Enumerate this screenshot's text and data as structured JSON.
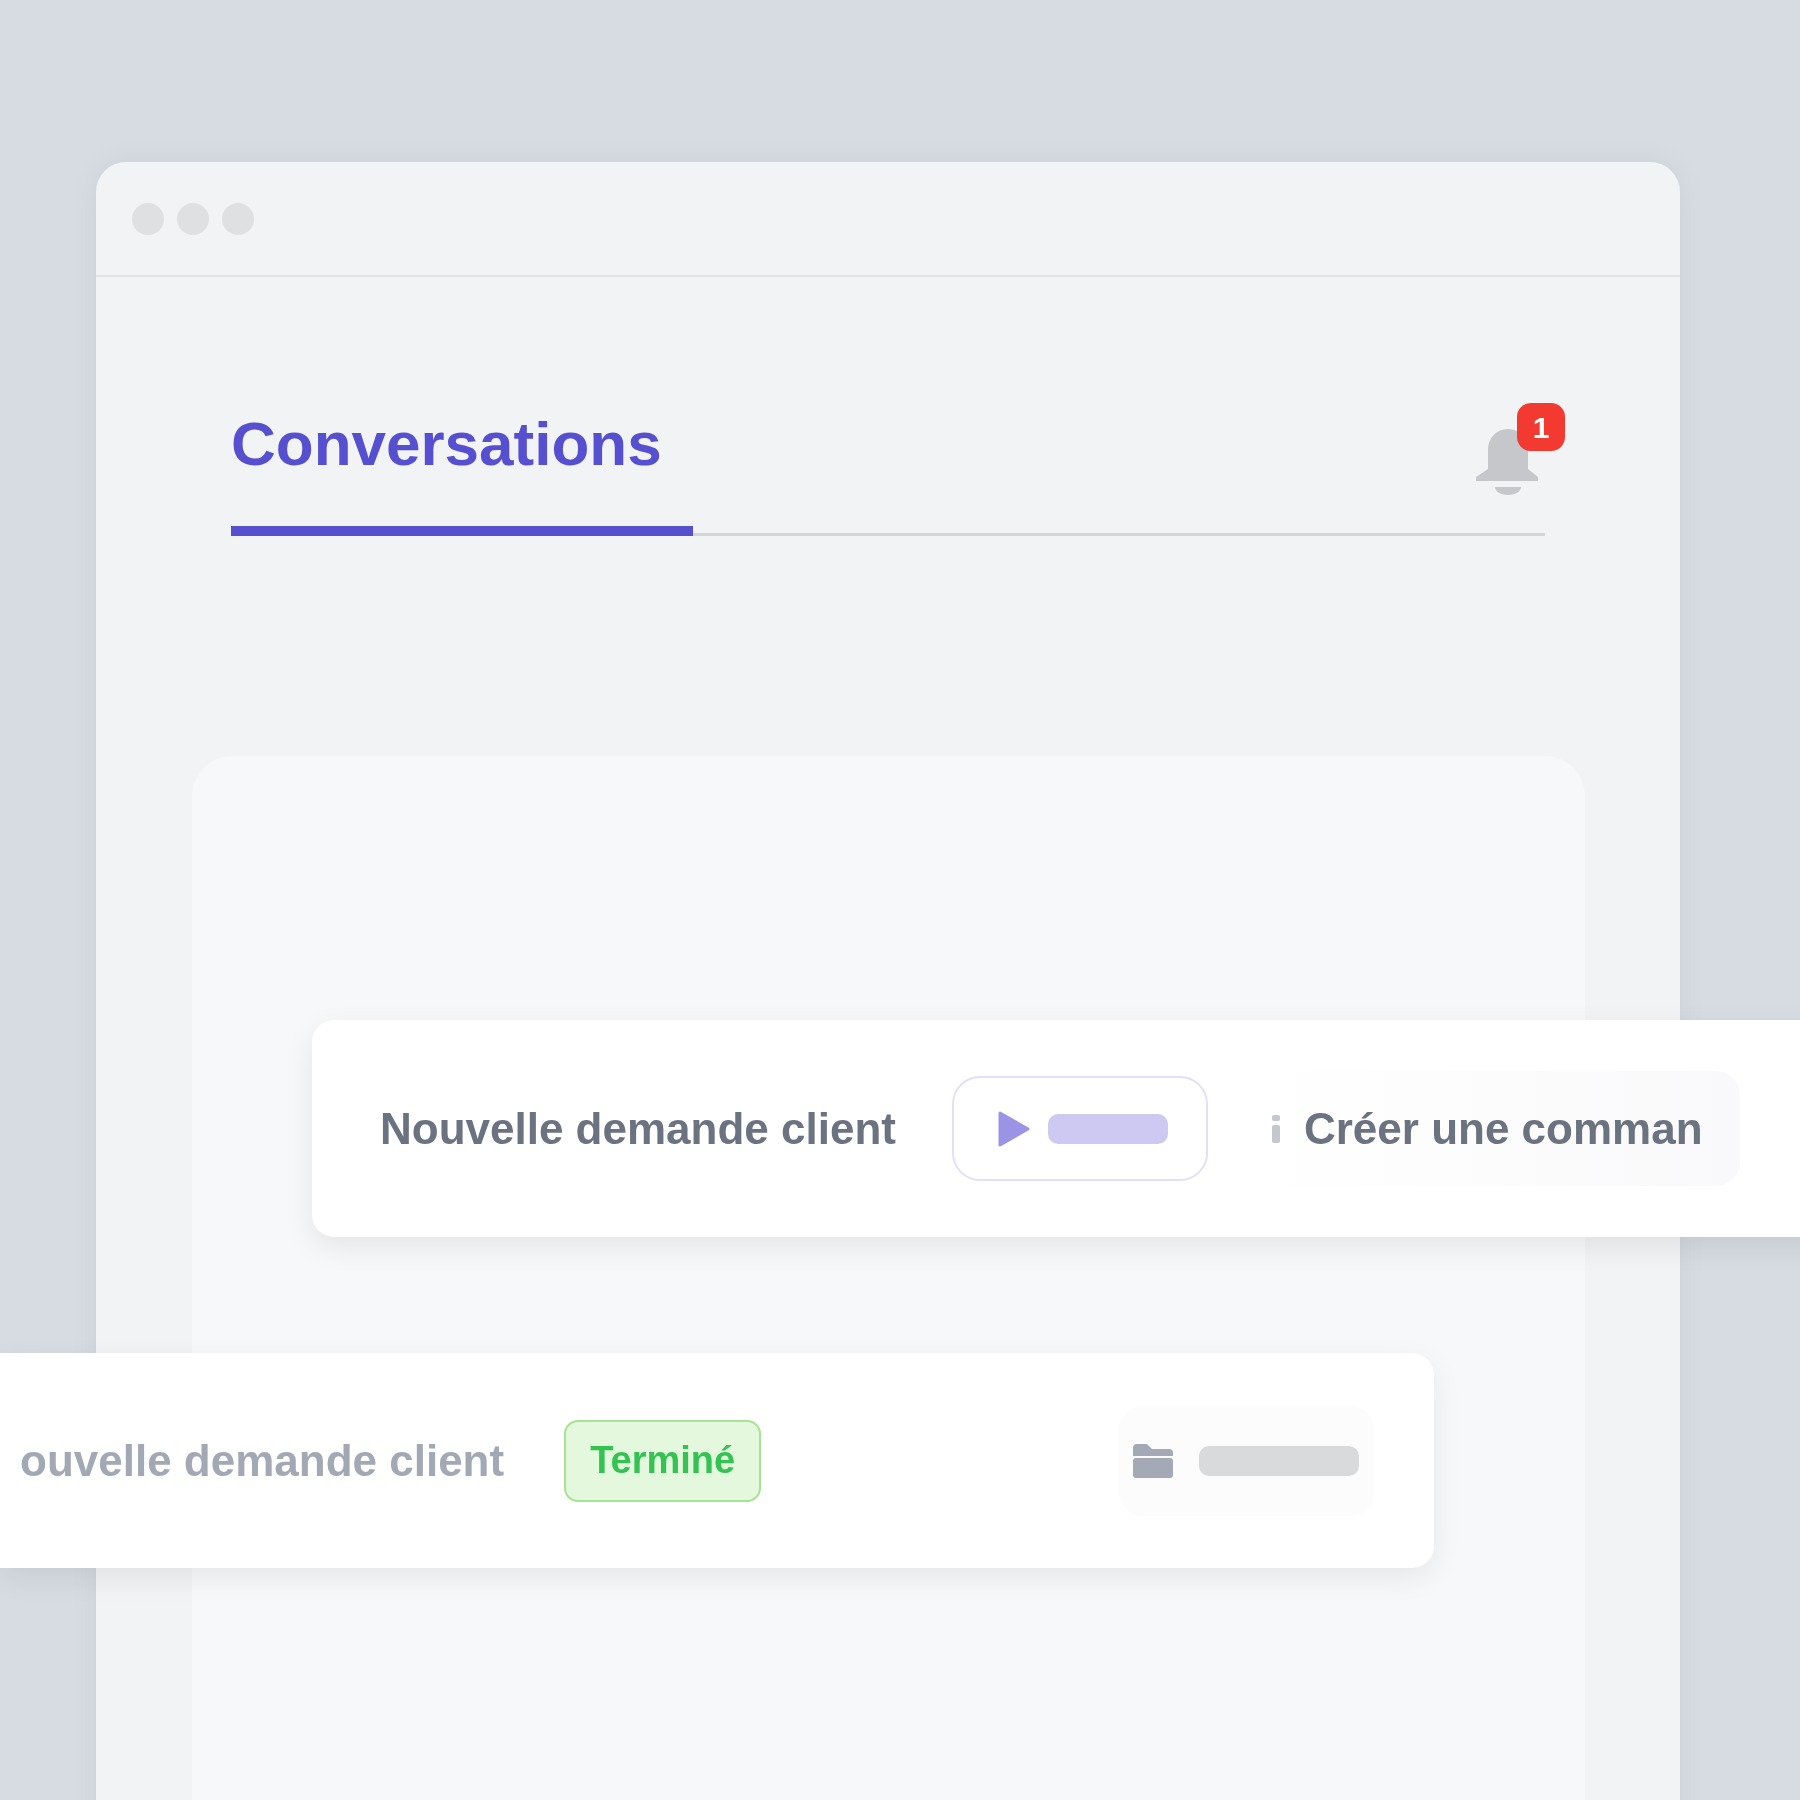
{
  "tabs": [
    {
      "label": "Conversations",
      "selected": true
    }
  ],
  "notifications": {
    "count": "1"
  },
  "rows": [
    {
      "title": "Nouvelle demande client",
      "kind": "action",
      "action": "Créer une comman"
    },
    {
      "title": "ouvelle demande client",
      "kind": "status",
      "status": "Terminé"
    }
  ]
}
